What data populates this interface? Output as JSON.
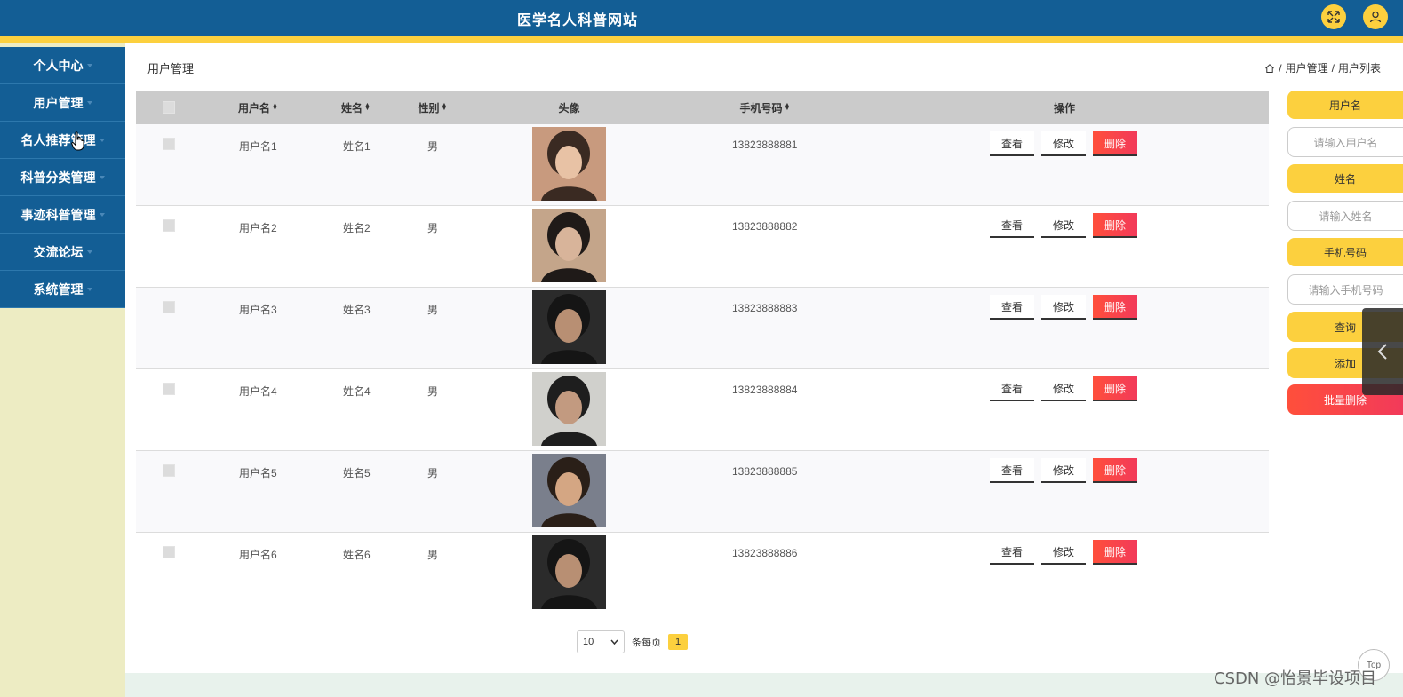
{
  "header": {
    "title": "医学名人科普网站",
    "fullscreen_icon": "expand-arrows-icon",
    "user_icon": "user-icon",
    "colors": {
      "bar": "#135e95",
      "accent": "#fcd03e"
    }
  },
  "sidebar": {
    "items": [
      {
        "label": "个人中心"
      },
      {
        "label": "用户管理"
      },
      {
        "label": "名人推荐管理"
      },
      {
        "label": "科普分类管理"
      },
      {
        "label": "事迹科普管理"
      },
      {
        "label": "交流论坛"
      },
      {
        "label": "系统管理"
      }
    ]
  },
  "page": {
    "title": "用户管理",
    "breadcrumb": [
      "用户管理",
      "用户列表"
    ],
    "breadcrumb_sep": "/"
  },
  "table": {
    "headers": {
      "username": "用户名",
      "name": "姓名",
      "gender": "性别",
      "avatar": "头像",
      "phone": "手机号码",
      "ops": "操作"
    },
    "rows": [
      {
        "username": "用户名1",
        "name": "姓名1",
        "gender": "男",
        "phone": "13823888881",
        "avatar": "photo-1"
      },
      {
        "username": "用户名2",
        "name": "姓名2",
        "gender": "男",
        "phone": "13823888882",
        "avatar": "photo-2"
      },
      {
        "username": "用户名3",
        "name": "姓名3",
        "gender": "男",
        "phone": "13823888883",
        "avatar": "photo-3"
      },
      {
        "username": "用户名4",
        "name": "姓名4",
        "gender": "男",
        "phone": "13823888884",
        "avatar": "photo-4"
      },
      {
        "username": "用户名5",
        "name": "姓名5",
        "gender": "男",
        "phone": "13823888885",
        "avatar": "photo-5"
      },
      {
        "username": "用户名6",
        "name": "姓名6",
        "gender": "男",
        "phone": "13823888886",
        "avatar": "photo-6"
      }
    ],
    "actions": {
      "view": "查看",
      "edit": "修改",
      "delete": "删除"
    }
  },
  "pagination": {
    "page_size": "10",
    "per_page_label": "条每页",
    "current_page": "1"
  },
  "search": {
    "username_label": "用户名",
    "username_placeholder": "请输入用户名",
    "name_label": "姓名",
    "name_placeholder": "请输入姓名",
    "phone_label": "手机号码",
    "phone_placeholder": "请输入手机号码",
    "query_button": "查询",
    "add_button": "添加",
    "batch_delete_button": "批量删除"
  },
  "misc": {
    "top_button": "Top",
    "watermark": "CSDN @怡景毕设项目"
  }
}
